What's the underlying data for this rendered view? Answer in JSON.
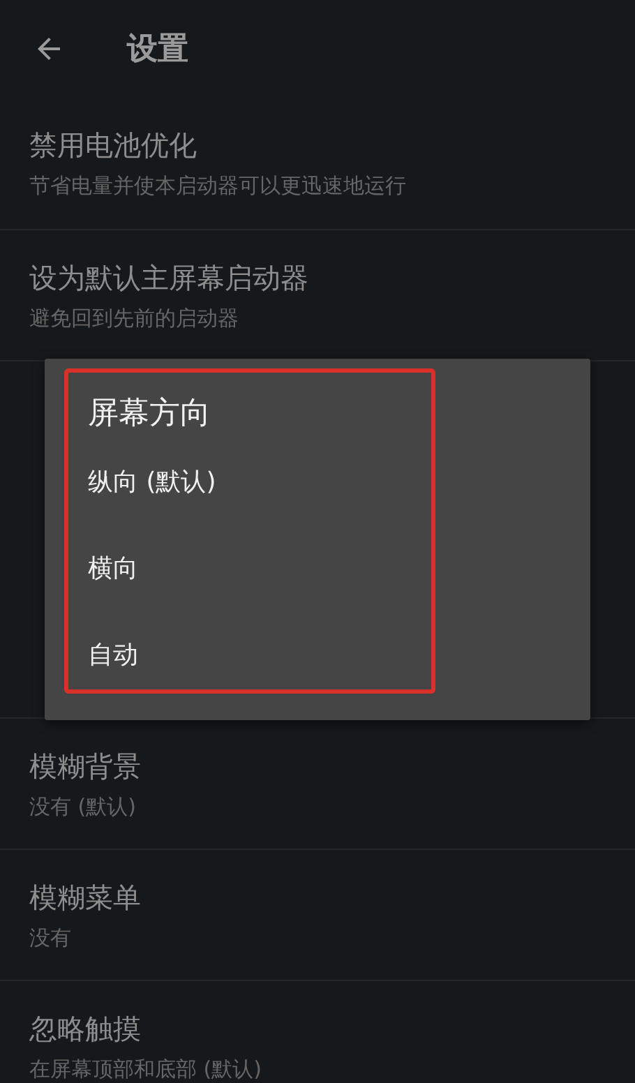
{
  "app_bar": {
    "title": "设置"
  },
  "settings": [
    {
      "kind": "item",
      "title": "禁用电池优化",
      "summary": "节省电量并使本启动器可以更迅速地运行"
    },
    {
      "kind": "item",
      "title": "设为默认主屏幕启动器",
      "summary": "避免回到先前的启动器"
    },
    {
      "kind": "item",
      "title": "模糊背景",
      "summary": "没有 (默认)"
    },
    {
      "kind": "item",
      "title": "模糊菜单",
      "summary": "没有"
    },
    {
      "kind": "item",
      "title": "忽略触摸",
      "summary": "在屏幕顶部和底部 (默认)"
    }
  ],
  "dialog": {
    "title": "屏幕方向",
    "options": [
      "纵向 (默认)",
      "横向",
      "自动"
    ],
    "highlighted": true
  }
}
